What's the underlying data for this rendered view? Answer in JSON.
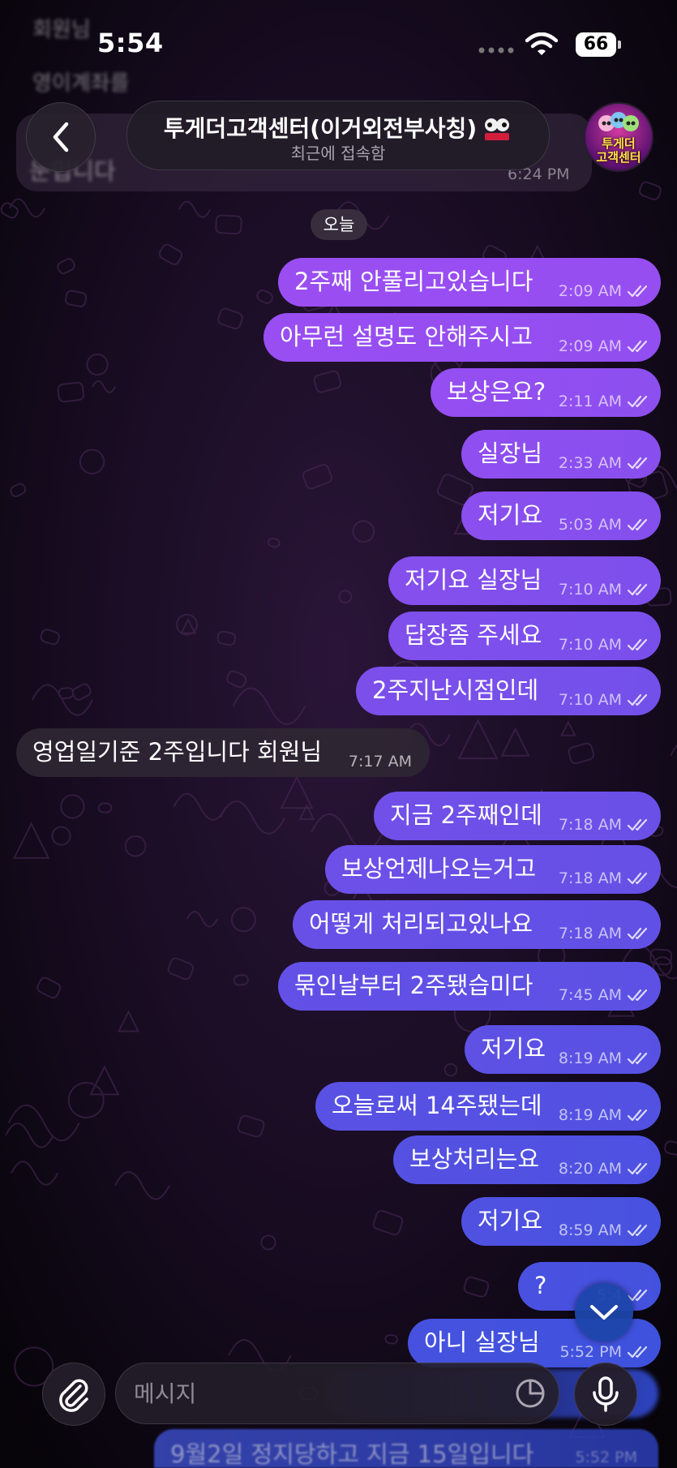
{
  "status_bar": {
    "time": "5:54",
    "battery": "66"
  },
  "ghost_content": {
    "top_line_1": "회원님",
    "top_line_2": "영이계좌를",
    "prev_bubble_text": "눈입니다",
    "prev_bubble_time": "6:24 PM"
  },
  "header": {
    "title": "투게더고객센터(이거외전부사칭)",
    "subtitle": "최근에 접속함",
    "avatar_text_1": "투게더",
    "avatar_text_2": "고객센터"
  },
  "date_chip": "오늘",
  "messages": [
    {
      "dir": "out",
      "text": "2주째 안풀리고있습니다",
      "time": "2:09 AM"
    },
    {
      "dir": "out",
      "text": "아무런 설명도 안해주시고",
      "time": "2:09 AM"
    },
    {
      "dir": "out",
      "text": "보상은요?",
      "time": "2:11 AM"
    },
    {
      "dir": "out",
      "text": "실장님",
      "time": "2:33 AM"
    },
    {
      "dir": "out",
      "text": "저기요",
      "time": "5:03 AM"
    },
    {
      "dir": "out",
      "text": "저기요 실장님",
      "time": "7:10 AM"
    },
    {
      "dir": "out",
      "text": "답장좀 주세요",
      "time": "7:10 AM"
    },
    {
      "dir": "out",
      "text": "2주지난시점인데",
      "time": "7:10 AM"
    },
    {
      "dir": "in",
      "text": "영업일기준 2주입니다 회원님",
      "time": "7:17 AM"
    },
    {
      "dir": "out",
      "text": "지금 2주째인데",
      "time": "7:18 AM"
    },
    {
      "dir": "out",
      "text": "보상언제나오는거고",
      "time": "7:18 AM"
    },
    {
      "dir": "out",
      "text": "어떻게 처리되고있나요",
      "time": "7:18 AM"
    },
    {
      "dir": "out",
      "text": "묶인날부터 2주됐습미다",
      "time": "7:45 AM"
    },
    {
      "dir": "out",
      "text": "저기요",
      "time": "8:19 AM"
    },
    {
      "dir": "out",
      "text": "오늘로써 14주됐는데",
      "time": "8:19 AM"
    },
    {
      "dir": "out",
      "text": "보상처리는요",
      "time": "8:20 AM"
    },
    {
      "dir": "out",
      "text": "저기요",
      "time": "8:59 AM"
    },
    {
      "dir": "out",
      "text": "?",
      "time": "5:4"
    },
    {
      "dir": "out",
      "text": "아니 실장님",
      "time": "5:52 PM"
    }
  ],
  "partial_bottom": {
    "text": "9월2일 정지당하고 지금 15일입니다",
    "time": "5:52 PM"
  },
  "input": {
    "placeholder": "메시지"
  },
  "colors": {
    "bubble_top": "#9a4ef2",
    "bubble_bottom": "#3d52dd",
    "incoming": "#2e2634",
    "background": "#0d0812"
  },
  "icons": {
    "back": "chevron-left-icon",
    "attach": "paperclip-icon",
    "mic": "microphone-icon",
    "sticker": "sticker-icon",
    "scroll": "chevron-down-icon",
    "read": "double-check-icon"
  }
}
